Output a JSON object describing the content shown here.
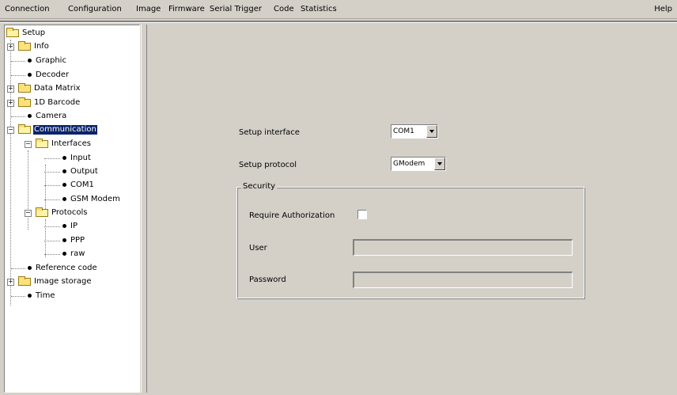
{
  "menubar": {
    "items": [
      "Connection",
      "Configuration",
      "Image",
      "Firmware",
      "Serial Trigger",
      "Code",
      "Statistics"
    ],
    "help": "Help"
  },
  "tree": {
    "root": "Setup",
    "info": "Info",
    "graphic": "Graphic",
    "decoder": "Decoder",
    "data_matrix": "Data Matrix",
    "barcode": "1D Barcode",
    "camera": "Camera",
    "communication": "Communication",
    "interfaces": "Interfaces",
    "input": "Input",
    "output": "Output",
    "com1": "COM1",
    "gsm_modem": "GSM Modem",
    "protocols": "Protocols",
    "ip": "IP",
    "ppp": "PPP",
    "raw": "raw",
    "reference_code": "Reference code",
    "image_storage": "Image storage",
    "time": "Time",
    "expand_plus": "+",
    "expand_minus": "−"
  },
  "form": {
    "setup_interface_label": "Setup interface",
    "setup_interface_value": "COM1",
    "setup_protocol_label": "Setup protocol",
    "setup_protocol_value": "GModem",
    "security_title": "Security",
    "require_auth_label": "Require Authorization",
    "require_auth_checked": false,
    "user_label": "User",
    "user_value": "",
    "password_label": "Password",
    "password_value": ""
  },
  "colors": {
    "window_bg": "#d4d0c8",
    "selection": "#0a246a",
    "folder": "#fbe37a"
  }
}
